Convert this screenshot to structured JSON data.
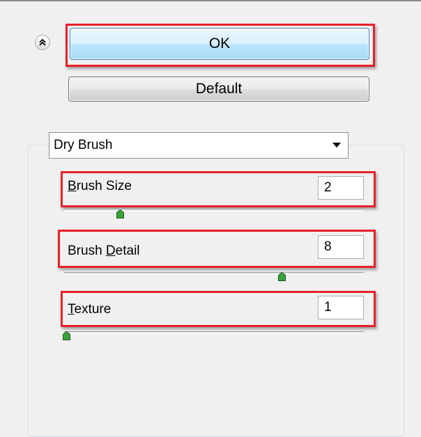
{
  "buttons": {
    "ok_label": "OK",
    "default_label": "Default"
  },
  "filter": {
    "selected": "Dry Brush"
  },
  "params": [
    {
      "label": "Brush Size",
      "value": "2",
      "level": 0.2
    },
    {
      "label": "Brush Detail",
      "value": "8",
      "level": 0.8
    },
    {
      "label": "Texture",
      "value": "1",
      "level": 0.0
    }
  ],
  "icons": {
    "collapse": "double-chevron-up-icon",
    "dropdown": "dropdown-arrow-icon",
    "slider_thumb": "slider-thumb-icon"
  },
  "colors": {
    "highlight": "#e8202a",
    "thumb": "#3aa23a",
    "ok_border": "#3c7fb1"
  }
}
